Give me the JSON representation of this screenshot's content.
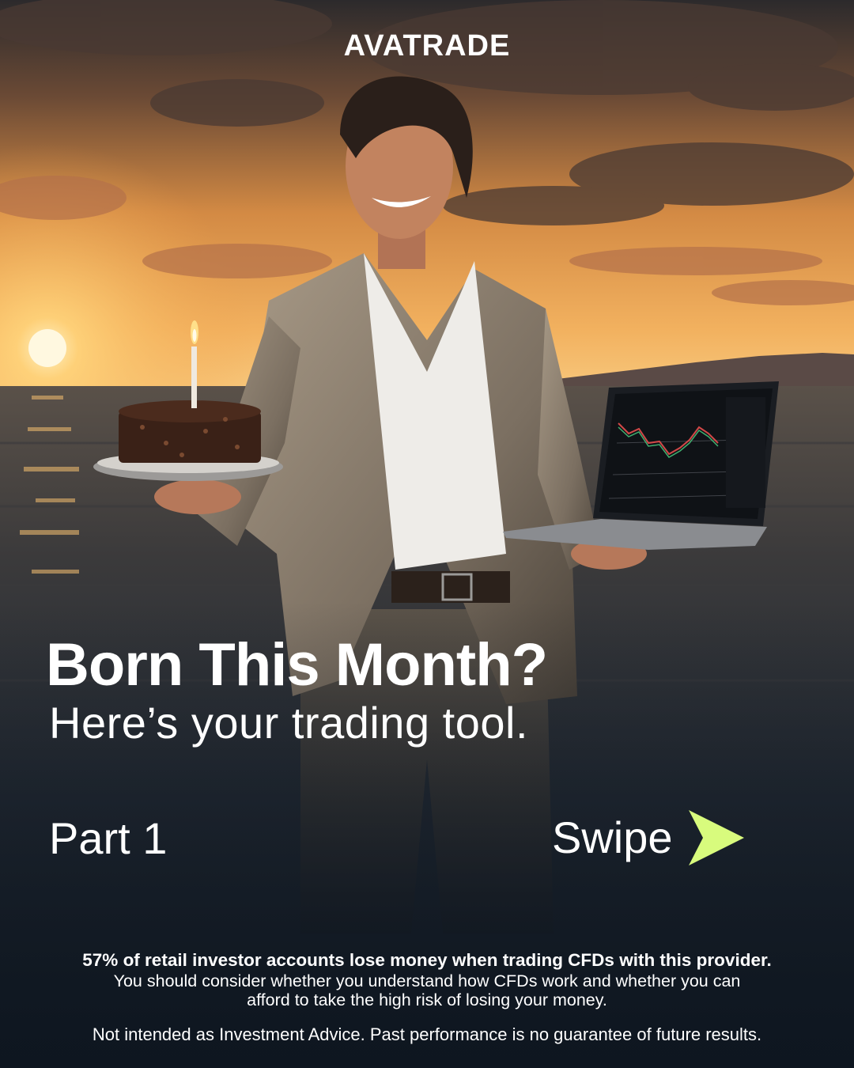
{
  "brand": {
    "name": "AVATRADE"
  },
  "headline": "Born This Month?",
  "subheadline": "Here’s your trading tool.",
  "part_label": "Part 1",
  "swipe": {
    "label": "Swipe",
    "icon": "arrow-right-icon",
    "icon_color": "#d8fb7d"
  },
  "disclaimer": {
    "risk_warning": "57% of retail investor accounts lose money when trading CFDs with this provider.",
    "risk_text": "You should consider whether you understand how CFDs work and whether you can afford to take the high risk of losing your money.",
    "advice": "Not intended as Investment Advice. Past performance is no guarantee of future results."
  },
  "colors": {
    "accent": "#d8fb7d",
    "text": "#ffffff",
    "sky": "#f0a04a",
    "sea": "#1b2530"
  }
}
